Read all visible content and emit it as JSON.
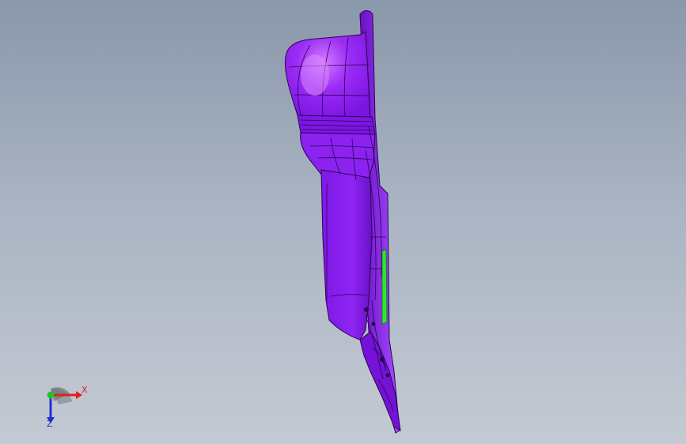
{
  "viewport": {
    "background_top": "#8a98ab",
    "background_bottom": "#c4cad3"
  },
  "model": {
    "color": "#8a1ff0",
    "edge_color": "#2a0550",
    "highlight_color": "#b85cff",
    "selected_face_color": "#2ee62e"
  },
  "triad": {
    "x_label": "X",
    "z_label": "Z",
    "x_color": "#e0201c",
    "y_color": "#22c422",
    "z_color": "#2030d0",
    "icon": "coordinate-triad-icon"
  }
}
